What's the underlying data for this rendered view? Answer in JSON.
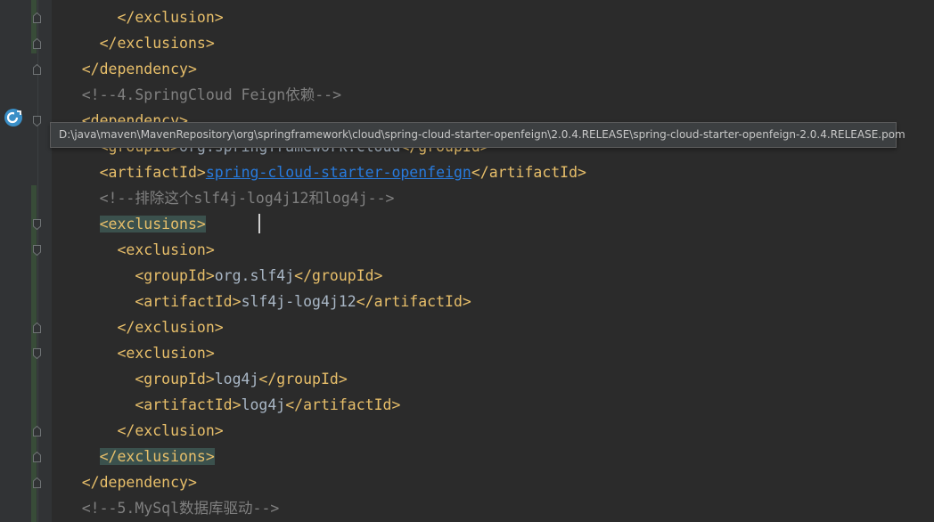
{
  "editor": {
    "tooltip_text": "D:\\java\\maven\\MavenRepository\\org\\springframework\\cloud\\spring-cloud-starter-openfeign\\2.0.4.RELEASE\\spring-cloud-starter-openfeign-2.0.4.RELEASE.pom",
    "colors": {
      "background": "#2b2b2b",
      "gutter": "#313335",
      "tag": "#e8bf6a",
      "comment": "#808080",
      "text": "#a9b7c6",
      "link": "#287bde",
      "brace_highlight": "#3b514d"
    },
    "lines": {
      "l0_tag": "</exclusion>",
      "l1_tag": "</exclusions>",
      "l2_tag": "</dependency>",
      "l3_comment": "<!--4.SpringCloud Feign依赖-->",
      "l4_tag": "<dependency>",
      "l5_open": "<groupId>",
      "l5_value": "org.springframework.cloud",
      "l5_close": "</groupId>",
      "l6_open": "<artifactId>",
      "l6_value": "spring-cloud-starter-openfeign",
      "l6_close": "</artifactId>",
      "l7_comment": "<!--排除这个slf4j-log4j12和log4j-->",
      "l8_tag": "<exclusions>",
      "l9_tag": "<exclusion>",
      "l10_open": "<groupId>",
      "l10_value": "org.slf4j",
      "l10_close": "</groupId>",
      "l11_open": "<artifactId>",
      "l11_value": "slf4j-log4j12",
      "l11_close": "</artifactId>",
      "l12_tag": "</exclusion>",
      "l13_tag": "<exclusion>",
      "l14_open": "<groupId>",
      "l14_value": "log4j",
      "l14_close": "</groupId>",
      "l15_open": "<artifactId>",
      "l15_value": "log4j",
      "l15_close": "</artifactId>",
      "l16_tag": "</exclusion>",
      "l17_tag": "</exclusions>",
      "l18_tag": "</dependency>",
      "l19_comment": "<!--5.MySql数据库驱动-->"
    },
    "icons": {
      "gutter_bean": "spring-bean-icon",
      "fold": "fold-marker-icon"
    }
  }
}
